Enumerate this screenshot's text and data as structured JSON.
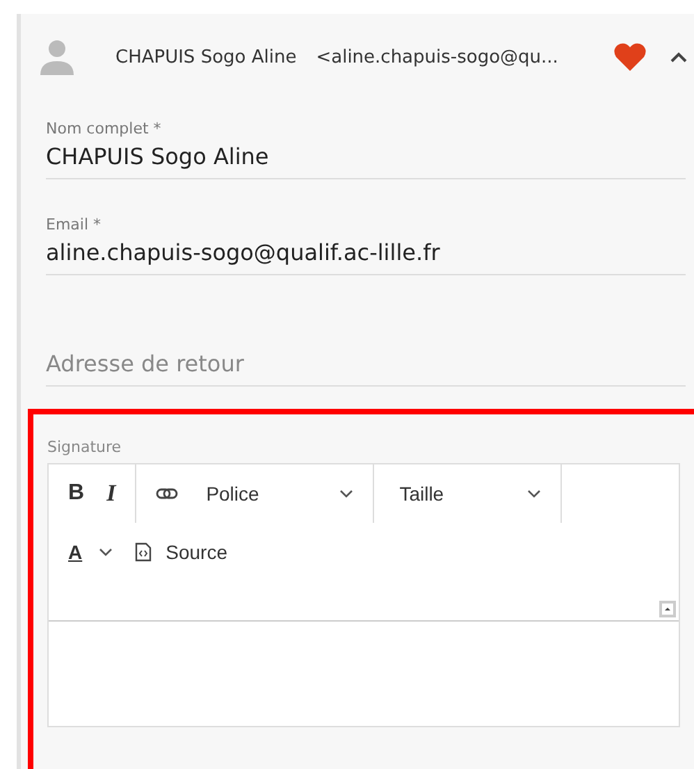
{
  "header": {
    "name": "CHAPUIS Sogo Aline",
    "email_preview": "<aline.chapuis-sogo@qu...",
    "favorite": true,
    "expanded": true
  },
  "fields": [
    {
      "kind": "filled",
      "label": "Nom complet *",
      "value": "CHAPUIS Sogo Aline"
    },
    {
      "kind": "filled",
      "label": "Email *",
      "value": "aline.chapuis-sogo@qualif.ac-lille.fr"
    },
    {
      "kind": "empty",
      "placeholder": "Adresse de retour"
    }
  ],
  "signature": {
    "label": "Signature",
    "highlighted": true,
    "toolbar_rows": [
      [
        [
          {
            "kind": "bold",
            "label": "B"
          },
          {
            "kind": "italic",
            "label": "I"
          }
        ],
        [
          {
            "kind": "link"
          },
          {
            "kind": "dropdown",
            "label": "Police"
          }
        ],
        [
          {
            "kind": "dropdown",
            "label": "Taille"
          }
        ]
      ],
      [
        [
          {
            "kind": "color",
            "label": "A"
          },
          {
            "kind": "source",
            "label": "Source"
          }
        ]
      ]
    ]
  }
}
